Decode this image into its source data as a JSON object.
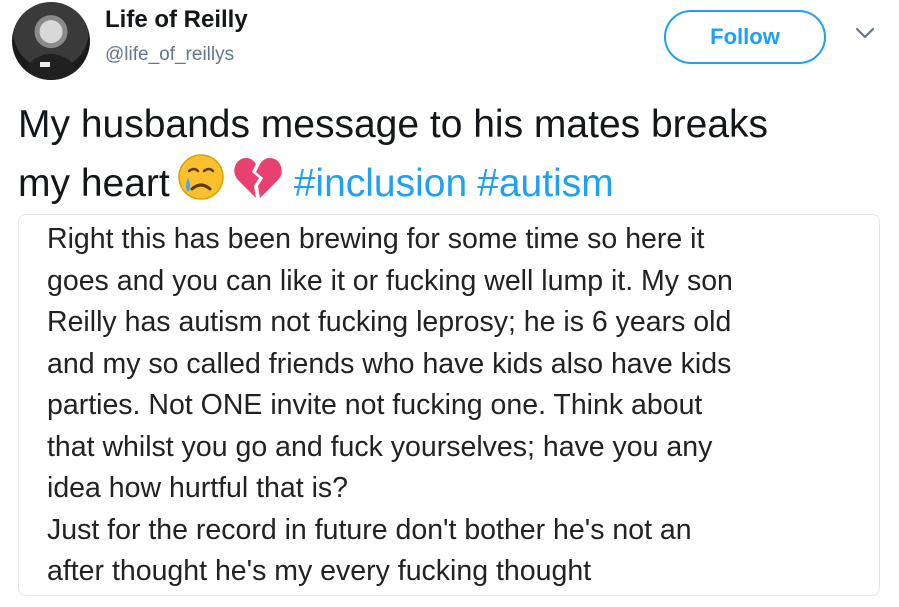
{
  "user": {
    "display_name": "Life of Reilly",
    "handle": "@life_of_reillys",
    "avatar_icon": "profile-photo"
  },
  "follow_button": {
    "label": "Follow"
  },
  "menu": {
    "icon": "chevron-down-icon"
  },
  "tweet": {
    "line1": "My husbands message to his mates  breaks",
    "line2_text": "my heart",
    "emojis": [
      "crying-face-emoji",
      "broken-heart-emoji"
    ],
    "hashtags": [
      "#inclusion",
      "#autism"
    ]
  },
  "image_text": {
    "lines": [
      "Right this has been brewing for some time so here it",
      "goes and you can like it or fucking well lump it. My son",
      "Reilly has autism not fucking leprosy; he is 6 years old",
      "and my so called friends who have kids also have kids",
      "parties. Not ONE invite not fucking one. Think about",
      "that whilst you go and fuck yourselves; have you any",
      "idea how hurtful that is?",
      "Just for the record in future don't bother he's not an",
      "after thought he's my every fucking thought"
    ]
  },
  "colors": {
    "brand_blue": "#1da1f2",
    "text": "#14171a",
    "secondary": "#657786",
    "border": "#e1e8ed"
  }
}
